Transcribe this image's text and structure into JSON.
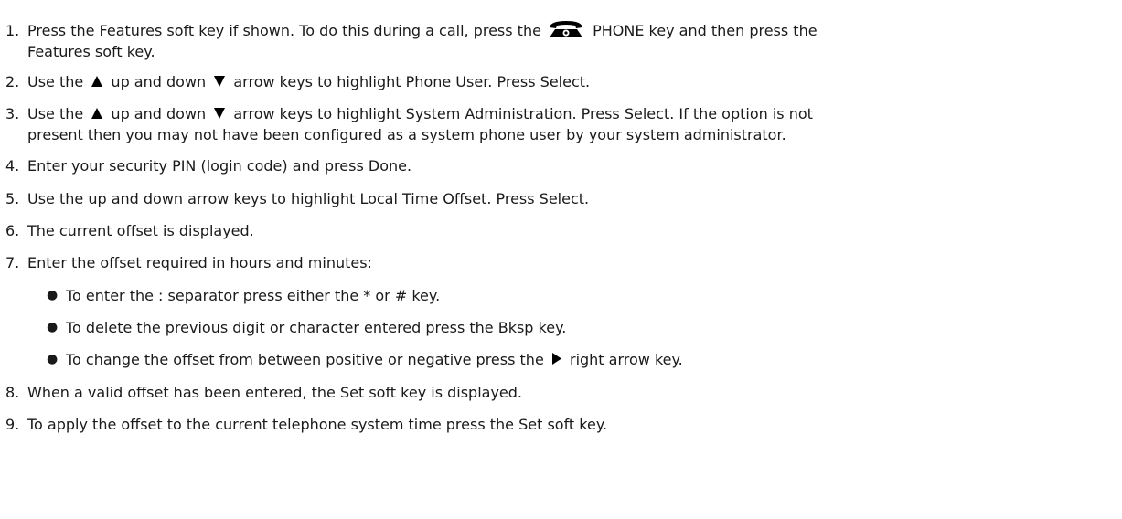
{
  "steps": [
    {
      "num": "1.",
      "pre": "Press the Features soft key if shown. To do this during a call, press the",
      "post": "PHONE key and then press the",
      "line2": "Features soft key."
    },
    {
      "num": "2.",
      "pre": "Use the",
      "mid": "up and down",
      "post": "arrow keys to highlight Phone User. Press Select."
    },
    {
      "num": "3.",
      "pre": "Use the",
      "mid": "up and down",
      "post": "arrow keys to highlight System Administration. Press Select. If the option is not",
      "line2": "present then you may not have been configured as a system phone user by your system administrator."
    },
    {
      "num": "4.",
      "text": "Enter your security PIN (login code) and press Done."
    },
    {
      "num": "5.",
      "text": "Use the up and down arrow keys to highlight Local Time Offset. Press Select."
    },
    {
      "num": "6.",
      "text": "The current offset is displayed."
    },
    {
      "num": "7.",
      "text": "Enter the offset required in hours and minutes:"
    },
    {
      "num": "8.",
      "text": "When a valid offset has been entered, the Set soft key is displayed."
    },
    {
      "num": "9.",
      "text": "To apply the offset to the current telephone system time press the Set soft key."
    }
  ],
  "bullets": [
    {
      "text": "To enter the : separator press either the * or # key."
    },
    {
      "text": "To delete the previous digit or character entered press the Bksp key."
    },
    {
      "pre": "To change the offset from between positive or negative press the",
      "post": "right arrow key."
    }
  ],
  "icons": {
    "phone": "phone-key-icon",
    "up": "up-arrow-icon",
    "down": "down-arrow-icon",
    "right": "right-arrow-icon"
  },
  "colors": {
    "text": "#1a1a1a",
    "icon": "#000000"
  }
}
